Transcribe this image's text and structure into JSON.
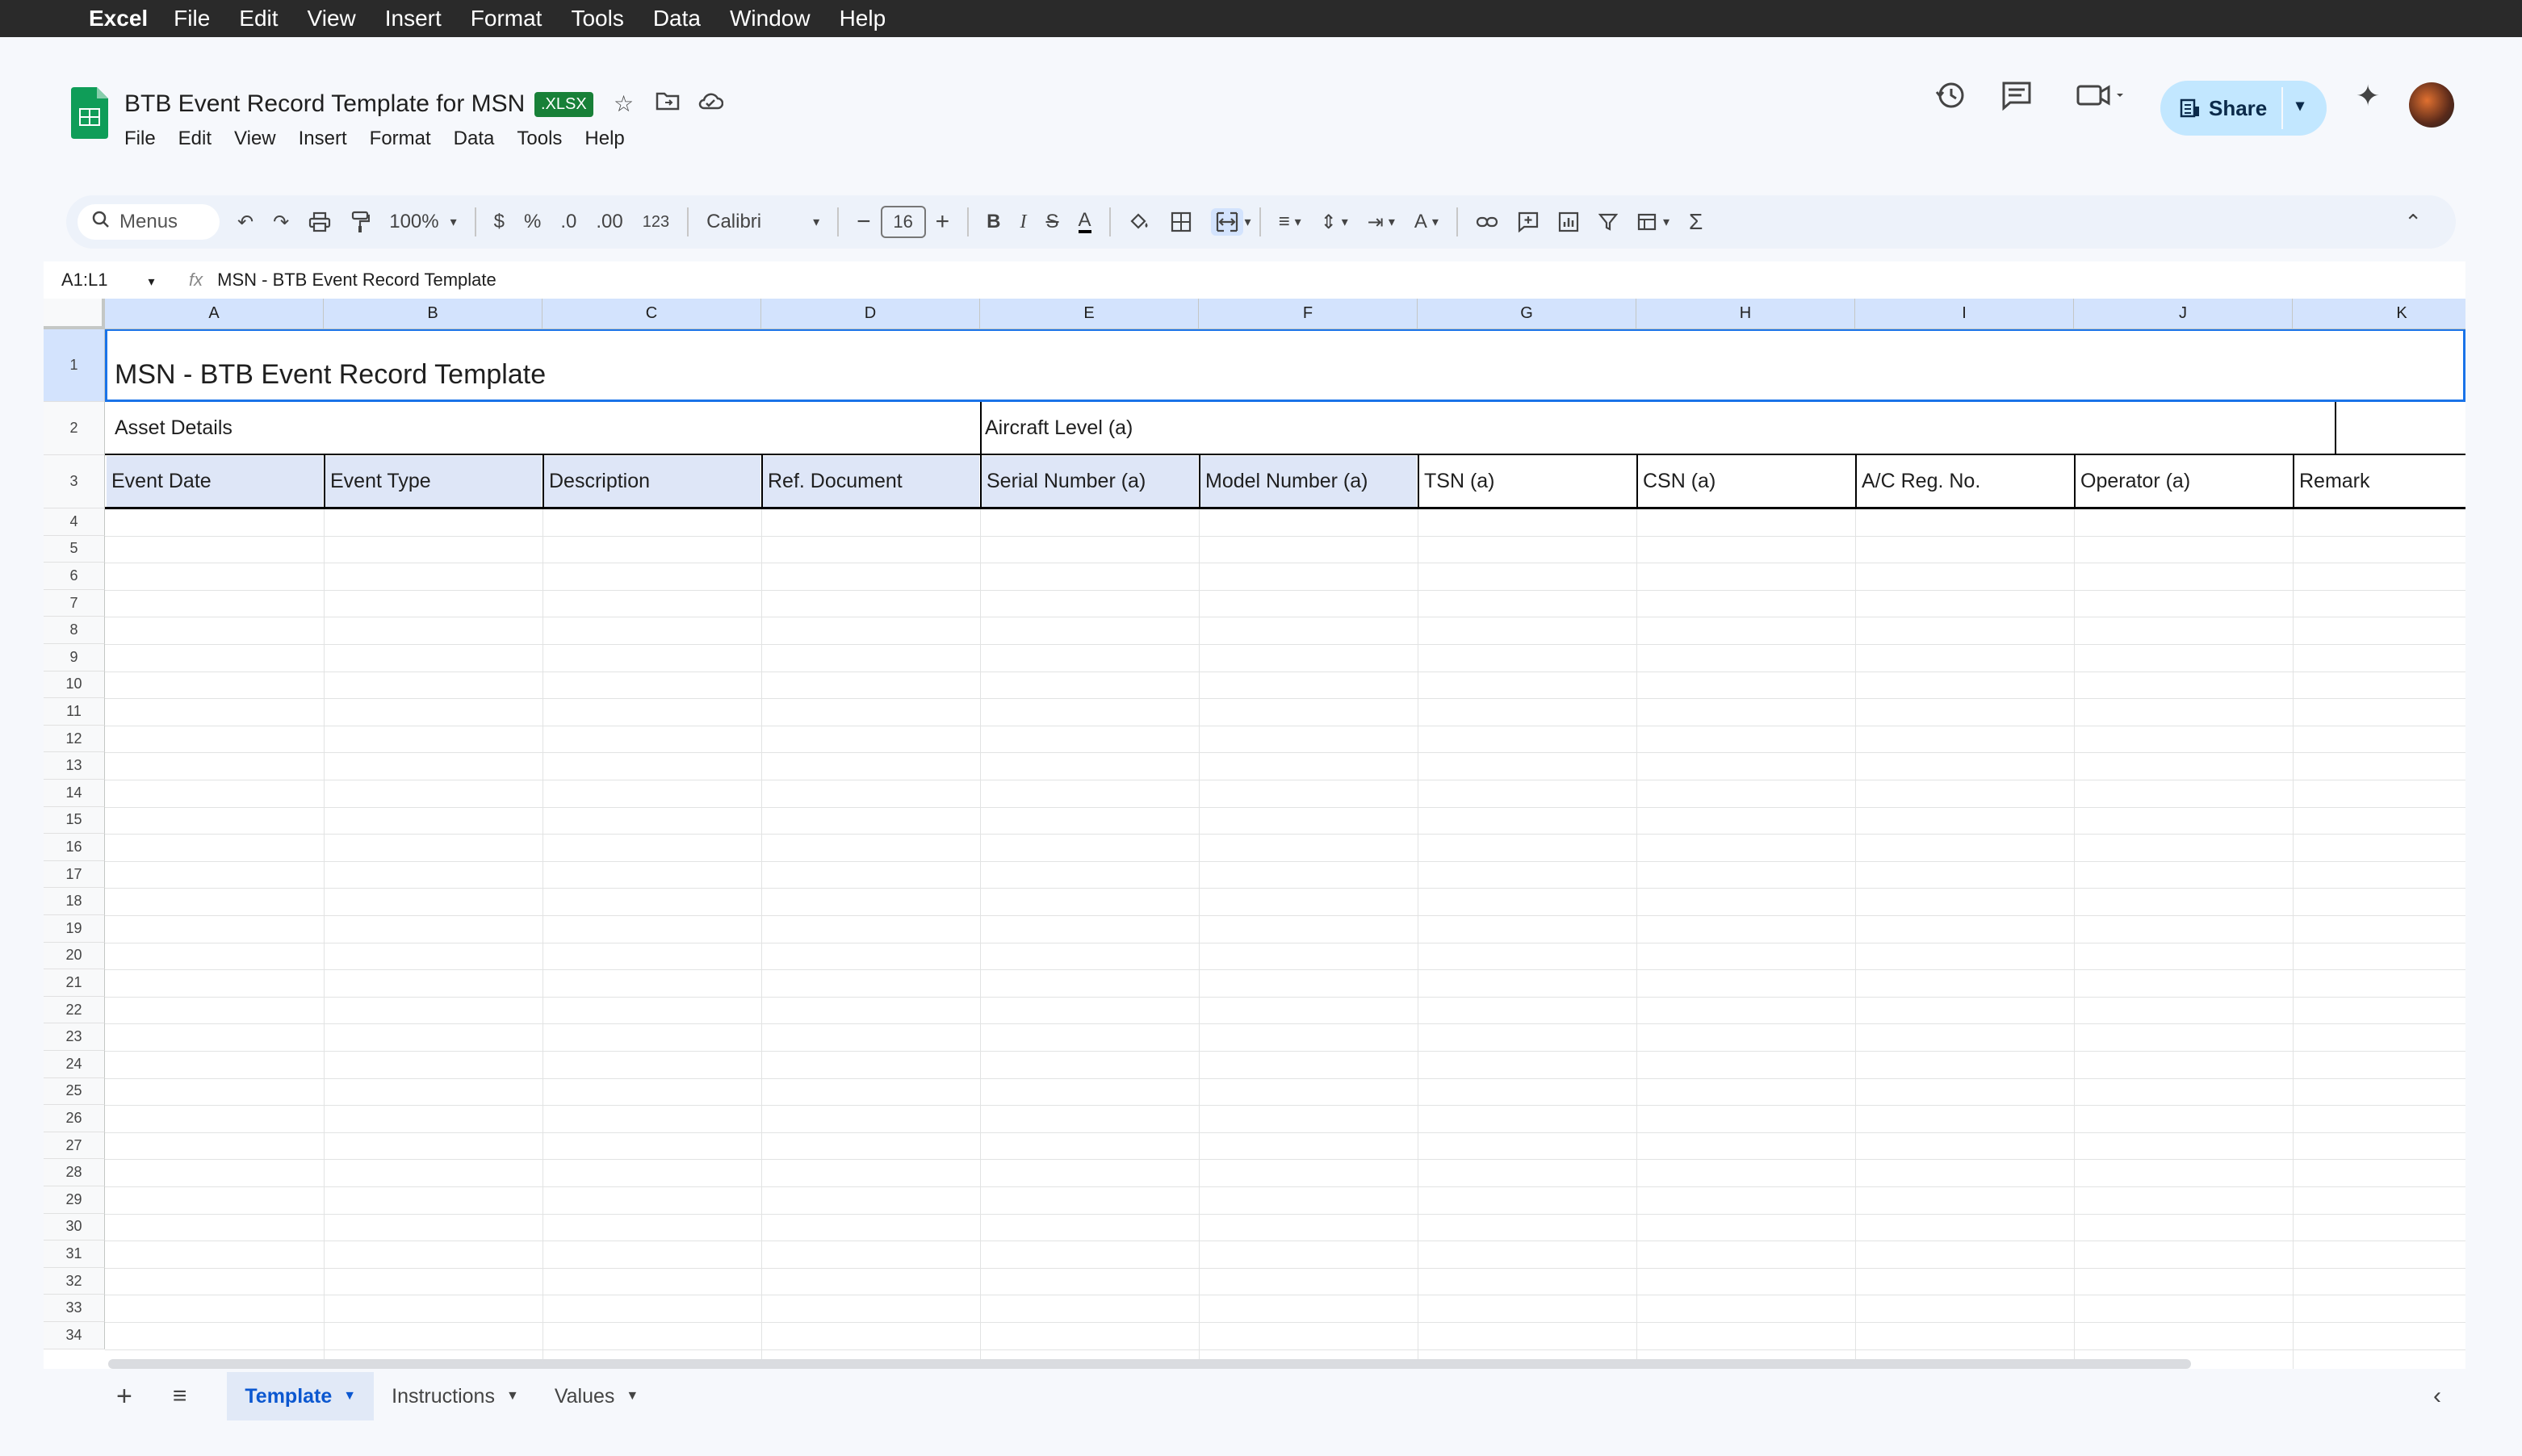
{
  "mac_menu": {
    "app": "Excel",
    "items": [
      "File",
      "Edit",
      "View",
      "Insert",
      "Format",
      "Tools",
      "Data",
      "Window",
      "Help"
    ]
  },
  "doc": {
    "title": "BTB Event Record Template for MSN",
    "badge": ".XLSX"
  },
  "doc_menu": [
    "File",
    "Edit",
    "View",
    "Insert",
    "Format",
    "Data",
    "Tools",
    "Help"
  ],
  "share_label": "Share",
  "toolbar": {
    "search": "Menus",
    "zoom": "100%",
    "currency": "$",
    "percent": "%",
    "dec_less": ".0",
    "dec_more": ".00",
    "number_fmt": "123",
    "font": "Calibri",
    "font_size": "16"
  },
  "formula_bar": {
    "name_box": "A1:L1",
    "fx": "fx",
    "formula": "MSN - BTB Event Record Template"
  },
  "columns": [
    "A",
    "B",
    "C",
    "D",
    "E",
    "F",
    "G",
    "H",
    "I",
    "J",
    "K"
  ],
  "rows": [
    "1",
    "2",
    "3",
    "4",
    "5",
    "6",
    "7",
    "8",
    "9",
    "10",
    "11",
    "12",
    "13",
    "14",
    "15",
    "16",
    "17",
    "18",
    "19",
    "20",
    "21",
    "22",
    "23",
    "24",
    "25",
    "26",
    "27",
    "28",
    "29",
    "30",
    "31",
    "32",
    "33",
    "34"
  ],
  "cells": {
    "title": "MSN - BTB Event Record Template",
    "asset_details": "Asset Details",
    "aircraft_level": "Aircraft Level (a)",
    "headers": [
      "Event Date",
      "Event Type",
      "Description",
      "Ref. Document",
      "Serial Number (a)",
      "Model Number (a)",
      "TSN (a)",
      "CSN (a)",
      "A/C Reg. No.",
      "Operator (a)",
      "Remark"
    ]
  },
  "sheets": [
    {
      "name": "Template",
      "active": true
    },
    {
      "name": "Instructions",
      "active": false
    },
    {
      "name": "Values",
      "active": false
    }
  ]
}
